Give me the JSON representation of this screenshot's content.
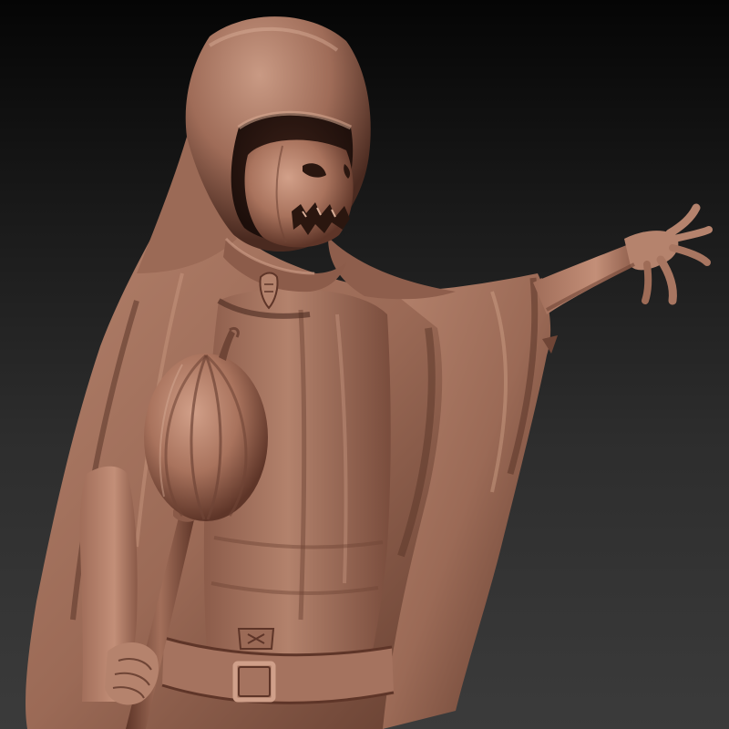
{
  "scene": {
    "subject": "hooded-pumpkin-head-figure-sculpt",
    "material_colors": {
      "clay_base": "#9a6a55",
      "clay_light": "#c08d76",
      "clay_mid": "#a57360",
      "clay_dark": "#6f4536",
      "clay_shadow": "#3e241c",
      "clay_highlight": "#d8ad96"
    },
    "background_colors": {
      "top": "#050505",
      "bottom": "#3b3b3b"
    }
  }
}
